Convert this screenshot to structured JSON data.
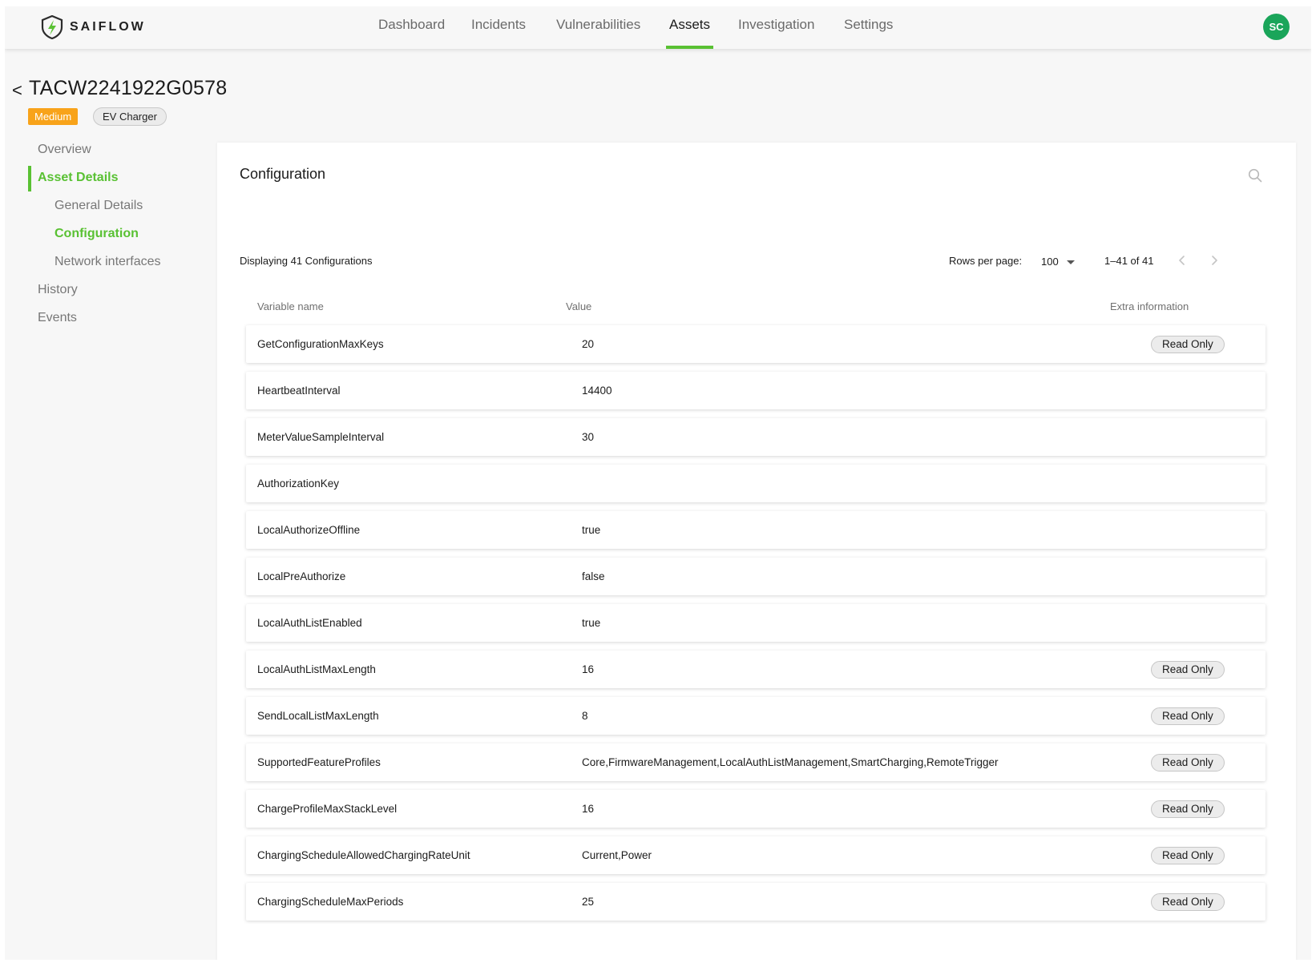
{
  "app": {
    "brand": "SAIFLOW",
    "user_initials": "SC"
  },
  "nav": {
    "items": [
      {
        "label": "Dashboard",
        "active": false
      },
      {
        "label": "Incidents",
        "active": false
      },
      {
        "label": "Vulnerabilities",
        "active": false
      },
      {
        "label": "Assets",
        "active": true
      },
      {
        "label": "Investigation",
        "active": false
      },
      {
        "label": "Settings",
        "active": false
      }
    ]
  },
  "asset": {
    "back_symbol": "<",
    "title": "TACW2241922G0578",
    "severity": "Medium",
    "type": "EV Charger"
  },
  "side_menu": {
    "items": [
      {
        "label": "Overview",
        "level": 1,
        "active": false
      },
      {
        "label": "Asset Details",
        "level": 1,
        "active": true
      },
      {
        "label": "General Details",
        "level": 2,
        "active": false
      },
      {
        "label": "Configuration",
        "level": 2,
        "active": true
      },
      {
        "label": "Network interfaces",
        "level": 2,
        "active": false
      },
      {
        "label": "History",
        "level": 1,
        "active": false
      },
      {
        "label": "Events",
        "level": 1,
        "active": false
      }
    ]
  },
  "configuration": {
    "title": "Configuration",
    "count_text": "Displaying 41 Configurations",
    "rows_per_page_label": "Rows per page:",
    "rows_per_page_value": "100",
    "range_text": "1–41 of 41",
    "columns": {
      "name": "Variable name",
      "value": "Value",
      "extra": "Extra information"
    },
    "rows": [
      {
        "name": "GetConfigurationMaxKeys",
        "value": "20",
        "extra": "Read Only"
      },
      {
        "name": "HeartbeatInterval",
        "value": "14400",
        "extra": ""
      },
      {
        "name": "MeterValueSampleInterval",
        "value": "30",
        "extra": ""
      },
      {
        "name": "AuthorizationKey",
        "value": "",
        "extra": ""
      },
      {
        "name": "LocalAuthorizeOffline",
        "value": "true",
        "extra": ""
      },
      {
        "name": "LocalPreAuthorize",
        "value": "false",
        "extra": ""
      },
      {
        "name": "LocalAuthListEnabled",
        "value": "true",
        "extra": ""
      },
      {
        "name": "LocalAuthListMaxLength",
        "value": "16",
        "extra": "Read Only"
      },
      {
        "name": "SendLocalListMaxLength",
        "value": "8",
        "extra": "Read Only"
      },
      {
        "name": "SupportedFeatureProfiles",
        "value": "Core,FirmwareManagement,LocalAuthListManagement,SmartCharging,RemoteTrigger",
        "extra": "Read Only"
      },
      {
        "name": "ChargeProfileMaxStackLevel",
        "value": "16",
        "extra": "Read Only"
      },
      {
        "name": "ChargingScheduleAllowedChargingRateUnit",
        "value": "Current,Power",
        "extra": "Read Only"
      },
      {
        "name": "ChargingScheduleMaxPeriods",
        "value": "25",
        "extra": "Read Only"
      }
    ]
  },
  "colors": {
    "accent": "#59c133",
    "severity_medium": "#f8a31a",
    "avatar": "#1aa55a"
  },
  "icons": {
    "logo": "saiflow-logo-icon",
    "search": "search-icon",
    "prev": "chevron-left-icon",
    "next": "chevron-right-icon",
    "dropdown": "caret-down-icon"
  }
}
